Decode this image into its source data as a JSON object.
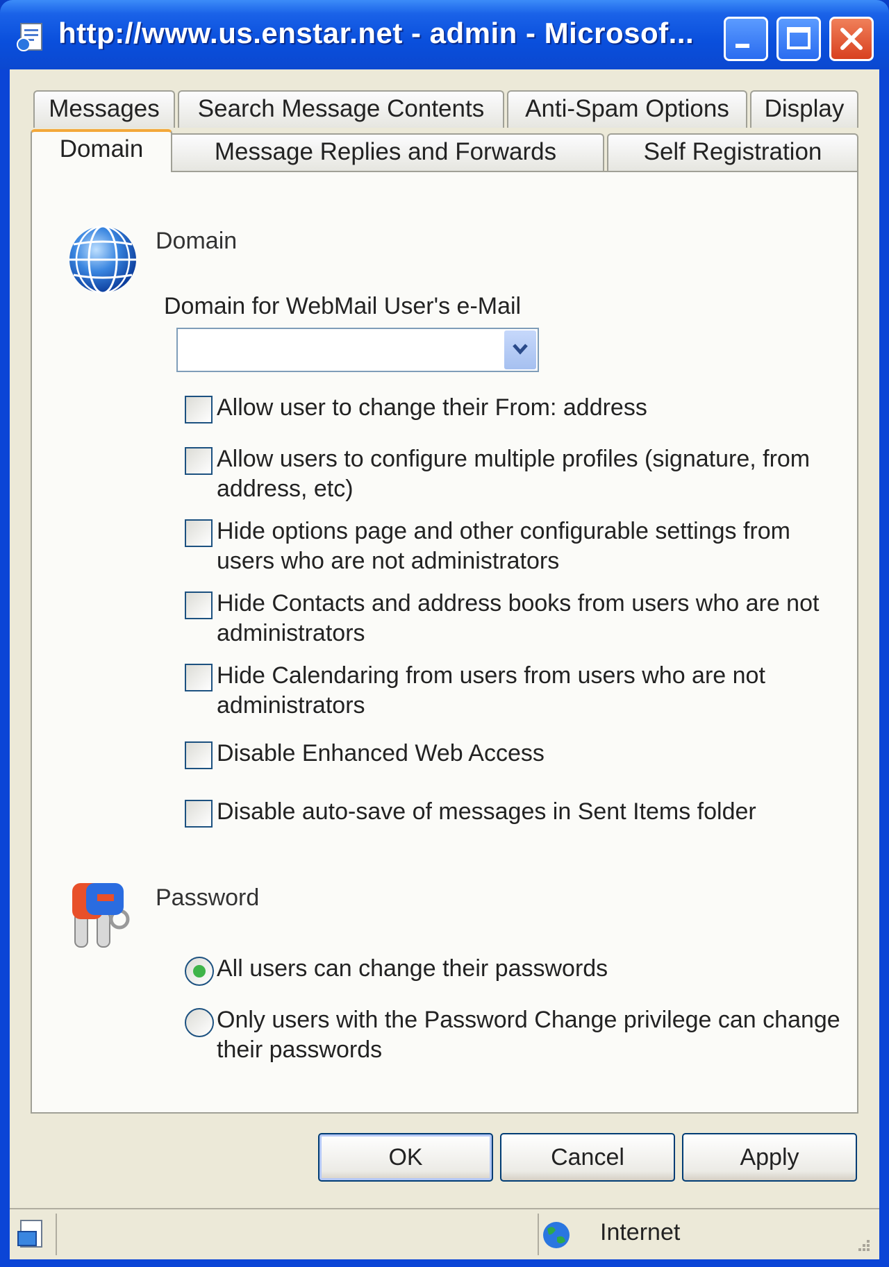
{
  "window": {
    "title": "http://www.us.enstar.net - admin - Microsof..."
  },
  "tabs": {
    "row1": [
      {
        "label": "Messages"
      },
      {
        "label": "Search Message Contents"
      },
      {
        "label": "Anti-Spam Options"
      },
      {
        "label": "Display"
      }
    ],
    "row2": [
      {
        "label": "Domain",
        "active": true
      },
      {
        "label": "Message Replies and Forwards"
      },
      {
        "label": "Self Registration"
      }
    ]
  },
  "domain_section": {
    "title": "Domain",
    "icon": "globe-icon",
    "select_label": "Domain for WebMail User's e-Mail",
    "select_value": "",
    "options": [
      {
        "label": "Allow user to change their From: address",
        "checked": false
      },
      {
        "label": "Allow users to configure multiple profiles (signature, from address, etc)",
        "checked": false
      },
      {
        "label": "Hide options page and other configurable settings from users who are not administrators",
        "checked": false
      },
      {
        "label": "Hide Contacts and address books from users who are not administrators",
        "checked": false
      },
      {
        "label": "Hide Calendaring from users from users who are not administrators",
        "checked": false
      },
      {
        "label": "Disable Enhanced Web Access",
        "checked": false
      },
      {
        "label": "Disable auto-save of messages in Sent Items folder",
        "checked": false
      }
    ]
  },
  "password_section": {
    "title": "Password",
    "icon": "keys-icon",
    "options": [
      {
        "label": "All users can change their passwords",
        "selected": true
      },
      {
        "label": "Only users with the Password Change privilege can change their passwords",
        "selected": false
      }
    ]
  },
  "buttons": {
    "ok": "OK",
    "cancel": "Cancel",
    "apply": "Apply"
  },
  "statusbar": {
    "zone": "Internet",
    "zone_icon": "globe-icon"
  },
  "colors": {
    "titlebar": "#0b48d0",
    "dialog_bg": "#ece9d8",
    "active_tab_accent": "#f3a83a",
    "radio_dot": "#3eb449"
  }
}
